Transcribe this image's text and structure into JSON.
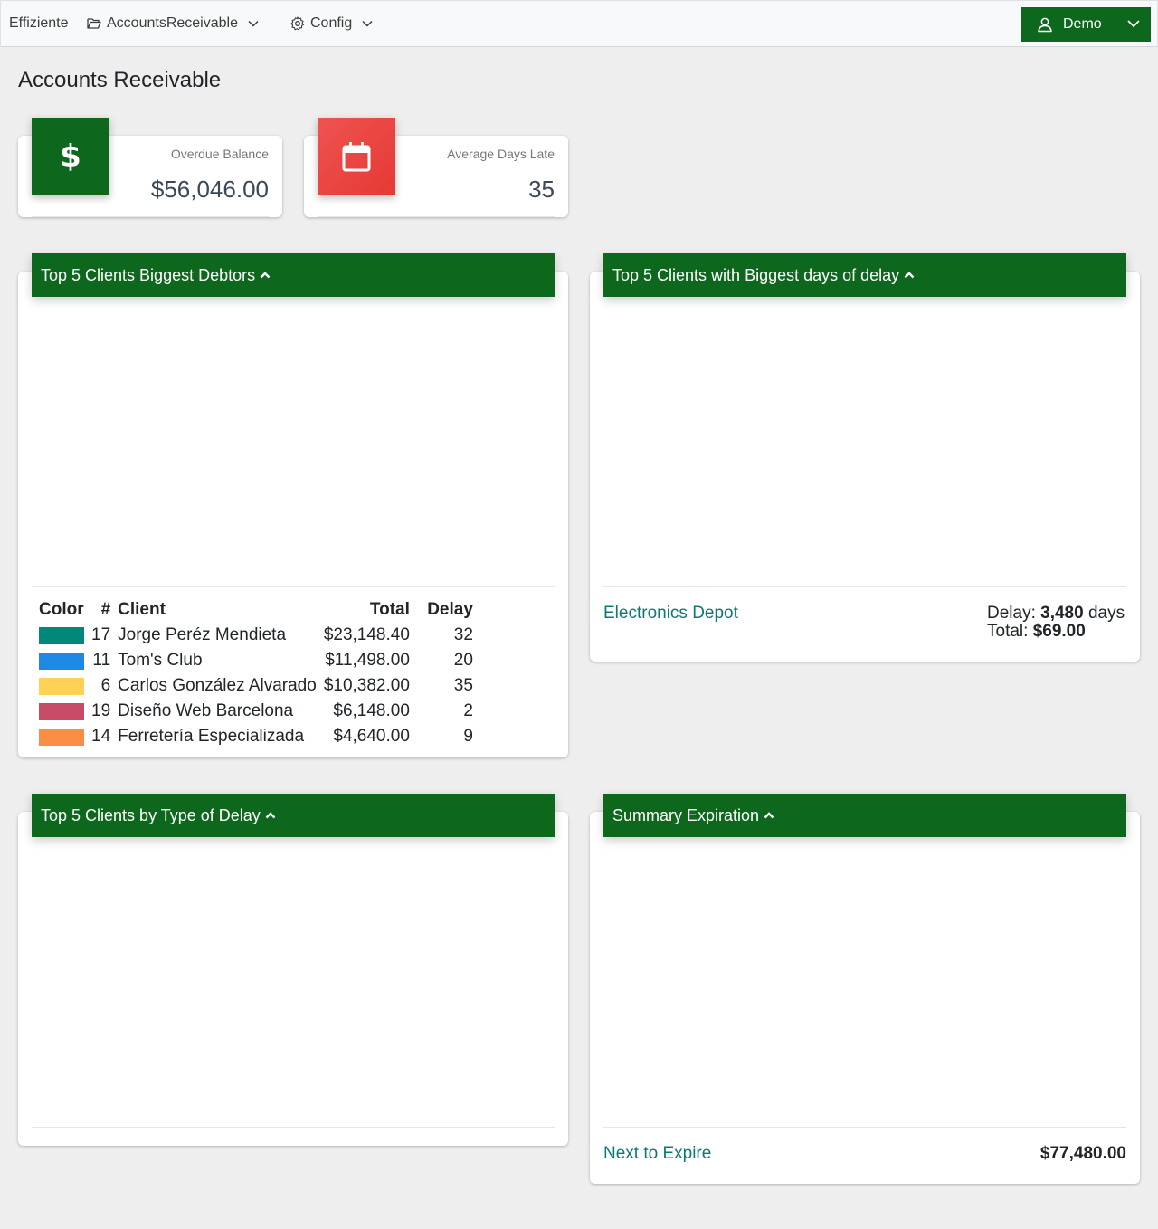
{
  "nav": {
    "brand": "Effiziente",
    "menu1": "AccountsReceivable",
    "menu2": "Config",
    "user": "Demo"
  },
  "page": {
    "title": "Accounts Receivable"
  },
  "stats": {
    "overdue": {
      "label": "Overdue Balance",
      "value": "$56,046.00",
      "icon": "dollar-icon",
      "color": "#0d681d"
    },
    "days": {
      "label": "Average Days Late",
      "value": "35",
      "icon": "calendar-icon",
      "color": "#e53935"
    }
  },
  "panels": {
    "debtors": {
      "title": "Top 5 Clients Biggest Debtors",
      "headers": {
        "color": "Color",
        "num": "#",
        "client": "Client",
        "total": "Total",
        "delay": "Delay"
      },
      "rows": [
        {
          "color": "#00897b",
          "num": "17",
          "client": "Jorge Peréz Mendieta",
          "total": "$23,148.40",
          "delay": "32"
        },
        {
          "color": "#1e88e5",
          "num": "11",
          "client": "Tom's Club",
          "total": "$11,498.00",
          "delay": "20"
        },
        {
          "color": "#ffd155",
          "num": "6",
          "client": "Carlos González Alvarado",
          "total": "$10,382.00",
          "delay": "35"
        },
        {
          "color": "#c84b66",
          "num": "19",
          "client": "Diseño Web Barcelona",
          "total": "$6,148.00",
          "delay": "2"
        },
        {
          "color": "#fb8c44",
          "num": "14",
          "client": "Ferretería Especializada",
          "total": "$4,640.00",
          "delay": "9"
        }
      ]
    },
    "delay": {
      "title": "Top 5 Clients with Biggest days of delay",
      "client": "Electronics Depot",
      "delay_label": "Delay:",
      "delay_value": "3,480",
      "delay_unit": "days",
      "total_label": "Total:",
      "total_value": "$69.00"
    },
    "type": {
      "title": "Top 5 Clients by Type of Delay"
    },
    "summary": {
      "title": "Summary Expiration",
      "link": "Next to Expire",
      "value": "$77,480.00"
    }
  }
}
